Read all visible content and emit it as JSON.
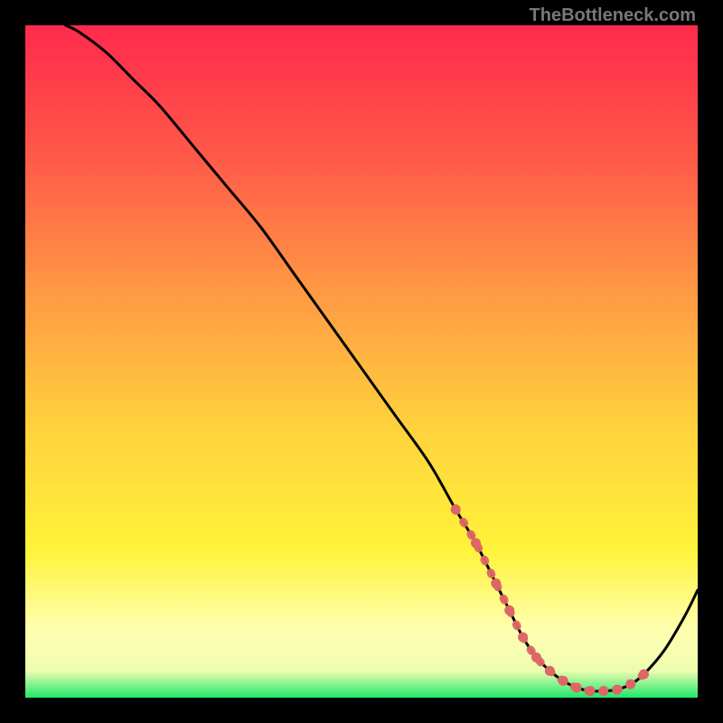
{
  "watermark": "TheBottleneck.com",
  "colors": {
    "black": "#000000",
    "curve": "#000000",
    "highlight": "#dd6666",
    "grad_top": "#ff2a4c",
    "grad_upper_mid": "#ff6b4a",
    "grad_mid": "#ffb040",
    "grad_lower_mid": "#fde738",
    "grad_near_bottom": "#ffffa0",
    "grad_bottom": "#1ee86a"
  },
  "chart_data": {
    "type": "line",
    "title": "",
    "xlabel": "",
    "ylabel": "",
    "xlim": [
      0,
      100
    ],
    "ylim": [
      0,
      100
    ],
    "series": [
      {
        "name": "curve",
        "x": [
          6,
          8,
          12,
          16,
          20,
          25,
          30,
          35,
          40,
          45,
          50,
          55,
          60,
          64,
          67,
          70,
          72,
          74,
          76,
          78,
          80,
          82,
          84,
          86,
          88,
          90,
          92,
          95,
          98,
          100
        ],
        "y": [
          100,
          99,
          96,
          92,
          88,
          82,
          76,
          70,
          63,
          56,
          49,
          42,
          35,
          28,
          23,
          17,
          13,
          9,
          6,
          4,
          2.5,
          1.5,
          1,
          1,
          1.2,
          2,
          3.5,
          7,
          12,
          16
        ]
      }
    ],
    "highlight_segment": {
      "x": [
        64,
        67,
        70,
        72,
        74,
        76,
        78,
        80,
        82,
        84,
        86,
        88,
        90,
        92
      ],
      "y": [
        28,
        23,
        17,
        13,
        9,
        6,
        4,
        2.5,
        1.5,
        1,
        1,
        1.2,
        2,
        3.5
      ],
      "note": "pink dotted overlay near valley"
    }
  }
}
